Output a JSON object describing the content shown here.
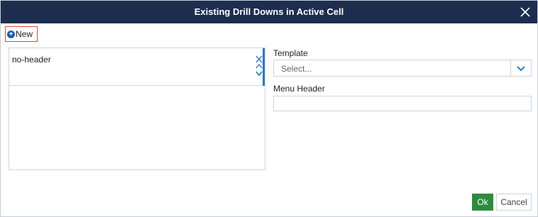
{
  "dialog": {
    "title": "Existing Drill Downs in Active Cell",
    "close_icon": "close-icon"
  },
  "toolbar": {
    "new_label": "New",
    "new_icon": "plus-circle-icon"
  },
  "list": {
    "items": [
      {
        "label": "no-header",
        "icons": [
          "close-icon",
          "chevron-up-icon",
          "chevron-down-icon"
        ]
      }
    ]
  },
  "form": {
    "template_label": "Template",
    "template_placeholder": "Select...",
    "menu_header_label": "Menu Header",
    "menu_header_value": ""
  },
  "footer": {
    "ok_label": "Ok",
    "cancel_label": "Cancel"
  },
  "colors": {
    "titlebar": "#1d2d4e",
    "accent": "#2f7bbf",
    "ok": "#2e8b3e",
    "highlight_border": "#e0453a"
  }
}
